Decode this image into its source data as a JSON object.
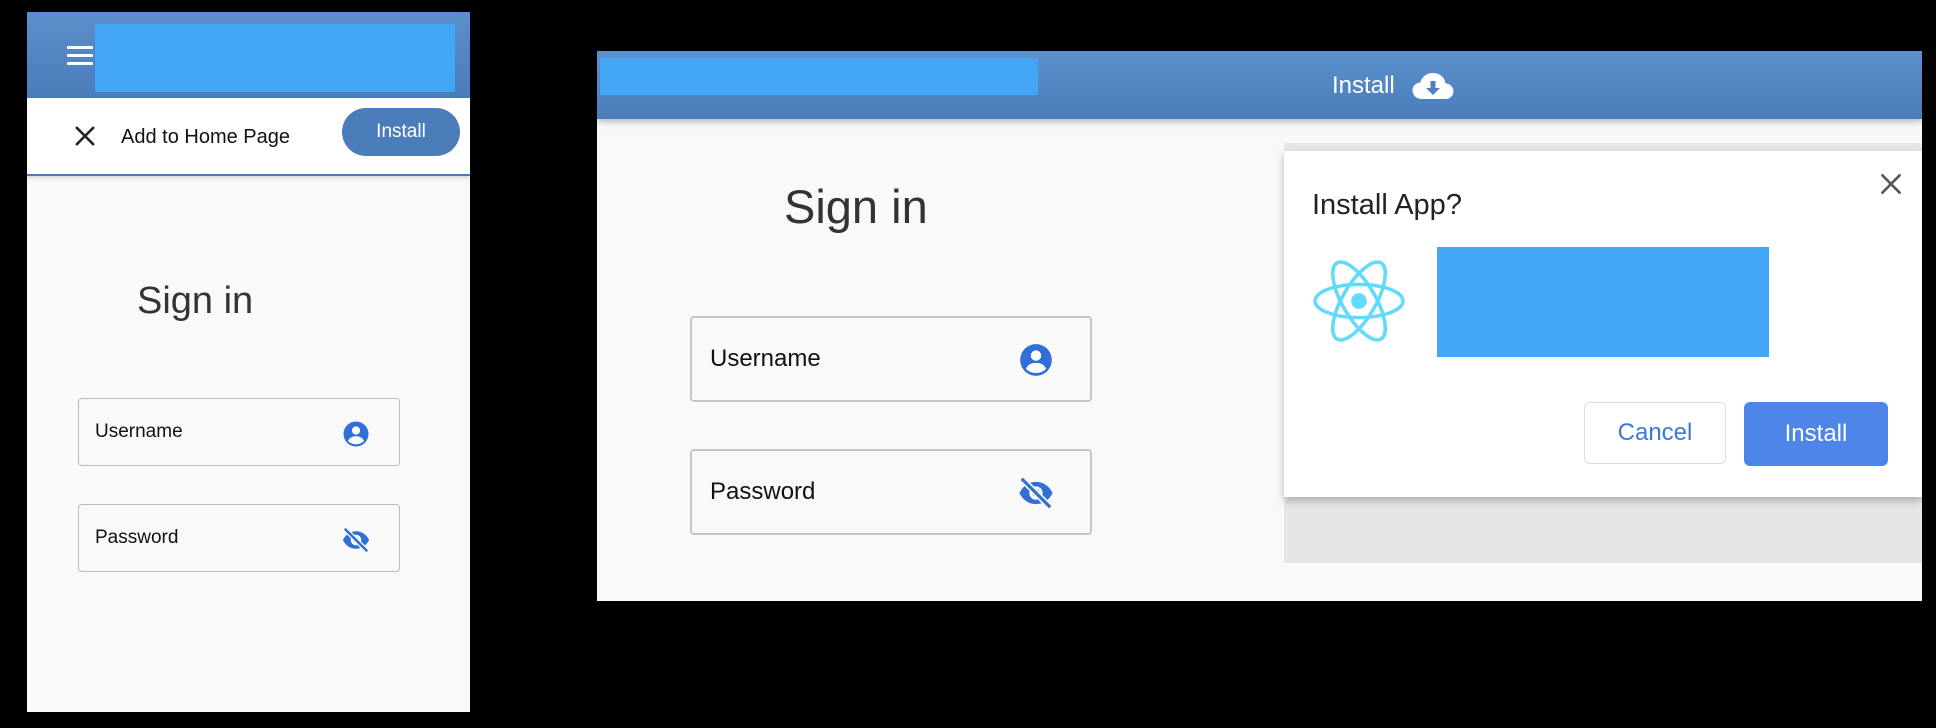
{
  "mobile": {
    "add_to_home": {
      "label": "Add to Home Page",
      "install_label": "Install"
    },
    "signin": {
      "title": "Sign in",
      "username_label": "Username",
      "password_label": "Password"
    }
  },
  "desktop": {
    "header": {
      "install_label": "Install"
    },
    "signin": {
      "title": "Sign in",
      "username_label": "Username",
      "password_label": "Password"
    },
    "dialog": {
      "title": "Install App?",
      "cancel_label": "Cancel",
      "install_label": "Install"
    }
  },
  "icons": {
    "menu": "menu-icon",
    "close": "close-icon",
    "account": "account-circle-icon",
    "visibility_off": "visibility-off-icon",
    "cloud_download": "cloud-download-icon",
    "app_logo": "react-logo"
  },
  "colors": {
    "app_bar": "#4a7db9",
    "accent": "#2f6fd6",
    "dialog_install": "#4e85e8",
    "redaction": "#42a5f5",
    "react_logo": "#61dafb"
  }
}
